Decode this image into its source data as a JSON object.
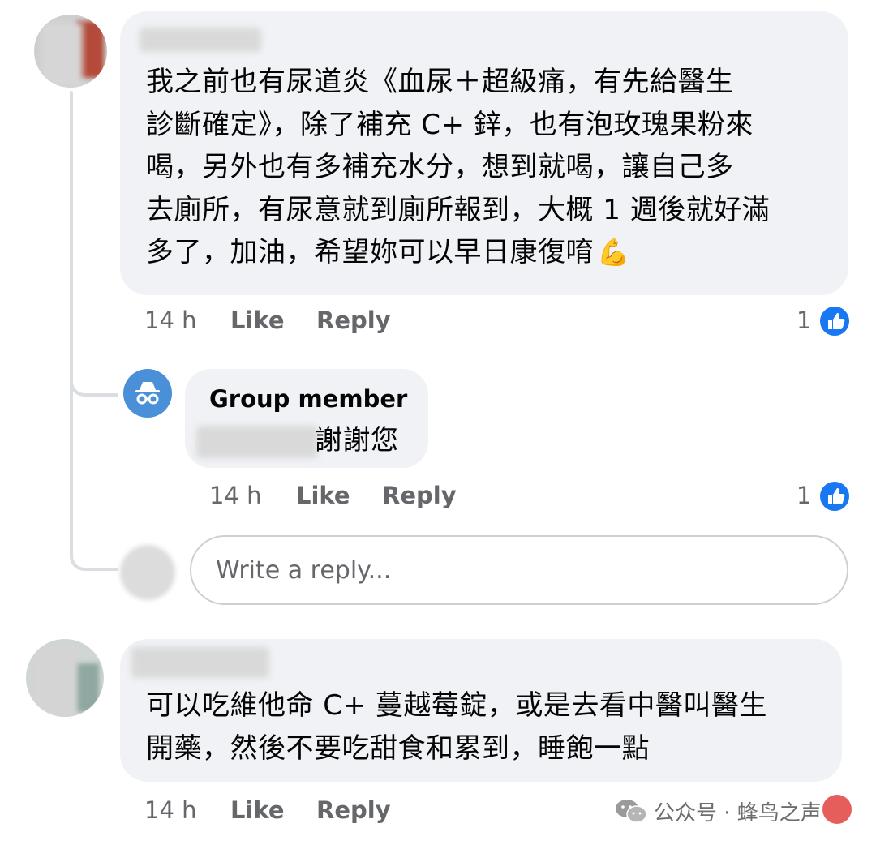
{
  "comments": [
    {
      "text_lines": [
        "我之前也有尿道炎《血尿＋超級痛，有先給醫生",
        "診斷確定》，除了補充 C+ 鋅，也有泡玫瑰果粉來",
        "喝，另外也有多補充水分，想到就喝，讓自己多",
        "去廁所，有尿意就到廁所報到，大概 1 週後就好滿",
        "多了，加油，希望妳可以早日康復唷"
      ],
      "emoji": "💪",
      "time": "14 h",
      "like_label": "Like",
      "reply_label": "Reply",
      "reaction_count": "1"
    },
    {
      "author": "Group member",
      "text": "謝謝您",
      "time": "14 h",
      "like_label": "Like",
      "reply_label": "Reply",
      "reaction_count": "1"
    },
    {
      "text_lines": [
        "可以吃維他命 C+ 蔓越莓錠，或是去看中醫叫醫生",
        "開藥，然後不要吃甜食和累到，睡飽一點"
      ],
      "time": "14 h",
      "like_label": "Like",
      "reply_label": "Reply"
    }
  ],
  "reply_box": {
    "placeholder": "Write a reply..."
  },
  "watermark": {
    "text": "公众号 · 蜂鸟之声"
  },
  "colors": {
    "like_blue": "#1877f2",
    "bubble_bg": "#f0f2f5",
    "meta_gray": "#65676b",
    "anon_avatar": "#4a90d9"
  }
}
